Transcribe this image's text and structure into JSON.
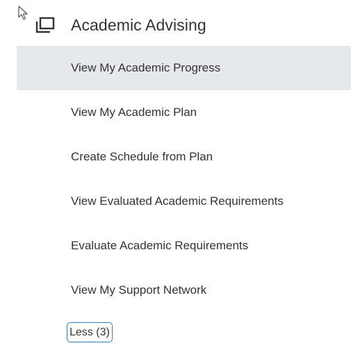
{
  "section": {
    "title": "Academic Advising",
    "icon": "window-restore-icon"
  },
  "menu": {
    "items": [
      {
        "label": "View My Academic Progress",
        "active": true
      },
      {
        "label": "View My Academic Plan",
        "active": false
      },
      {
        "label": "Create Schedule from Plan",
        "active": false
      },
      {
        "label": "View Evaluated Academic Requirements",
        "active": false
      },
      {
        "label": "Evaluate Academic Requirements",
        "active": false
      },
      {
        "label": "View My Support Network",
        "active": false
      }
    ]
  },
  "less_button": {
    "label": "Less (3)"
  },
  "colors": {
    "active_row_bg": "#e6e9ec",
    "focus_border": "#2c7fb8",
    "text": "#333333"
  }
}
